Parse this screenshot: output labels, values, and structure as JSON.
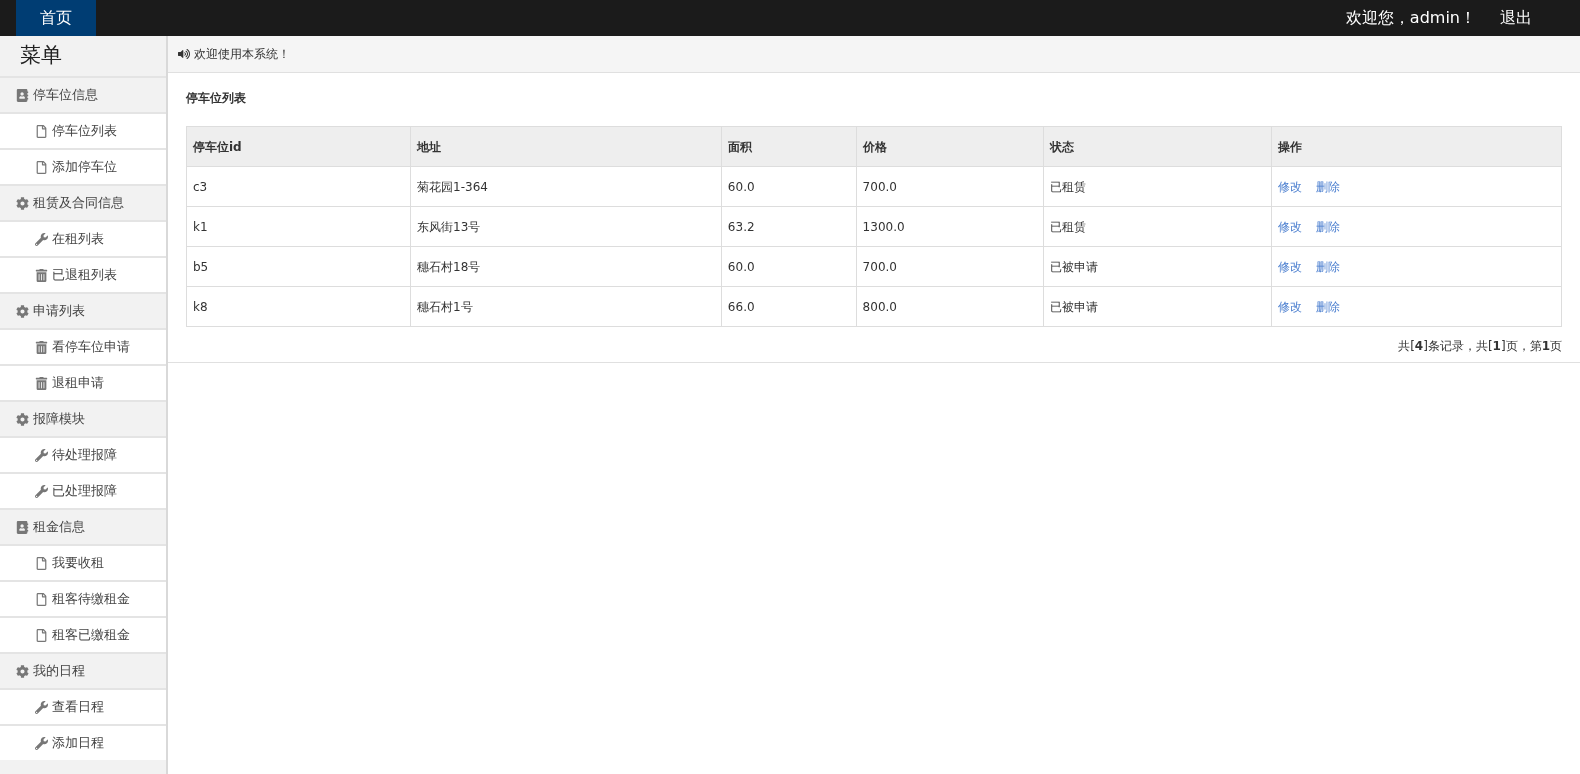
{
  "topbar": {
    "home_tab": {
      "label": "首页",
      "selected": true
    },
    "welcome": "欢迎您，admin！",
    "logout": "退出"
  },
  "sidebar": {
    "title": "菜单",
    "groups": [
      {
        "label": "停车位信息",
        "kind": "book",
        "items": [
          {
            "label": "停车位列表",
            "kind": "file"
          },
          {
            "label": "添加停车位",
            "kind": "file"
          }
        ]
      },
      {
        "label": "租赁及合同信息",
        "kind": "gear",
        "items": [
          {
            "label": "在租列表",
            "kind": "wrench"
          },
          {
            "label": "已退租列表",
            "kind": "trash"
          }
        ]
      },
      {
        "label": "申请列表",
        "kind": "gear",
        "items": [
          {
            "label": "看停车位申请",
            "kind": "trash"
          },
          {
            "label": "退租申请",
            "kind": "trash"
          }
        ]
      },
      {
        "label": "报障模块",
        "kind": "gear",
        "items": [
          {
            "label": "待处理报障",
            "kind": "wrench"
          },
          {
            "label": "已处理报障",
            "kind": "wrench"
          }
        ]
      },
      {
        "label": "租金信息",
        "kind": "book",
        "items": [
          {
            "label": "我要收租",
            "kind": "file"
          },
          {
            "label": "租客待缴租金",
            "kind": "file"
          },
          {
            "label": "租客已缴租金",
            "kind": "file"
          }
        ]
      },
      {
        "label": "我的日程",
        "kind": "gear",
        "items": [
          {
            "label": "查看日程",
            "kind": "wrench"
          },
          {
            "label": "添加日程",
            "kind": "wrench"
          }
        ]
      }
    ]
  },
  "notice": "欢迎使用本系统！",
  "panel_title": "停车位列表",
  "table": {
    "columns": [
      "停车位id",
      "地址",
      "面积",
      "价格",
      "状态",
      "操作"
    ],
    "rows": [
      {
        "cells": [
          "c3",
          "菊花园1-364",
          "60.0",
          "700.0",
          "已租赁"
        ],
        "actions": [
          "修改",
          "删除"
        ]
      },
      {
        "cells": [
          "k1",
          "东风街13号",
          "63.2",
          "1300.0",
          "已租赁"
        ],
        "actions": [
          "修改",
          "删除"
        ]
      },
      {
        "cells": [
          "b5",
          "穗石村18号",
          "60.0",
          "700.0",
          "已被申请"
        ],
        "actions": [
          "修改",
          "删除"
        ]
      },
      {
        "cells": [
          "k8",
          "穗石村1号",
          "66.0",
          "800.0",
          "已被申请"
        ],
        "actions": [
          "修改",
          "删除"
        ]
      }
    ]
  },
  "pagination": "共[**4**]条记录，共[**1**]页，第**1**页"
}
